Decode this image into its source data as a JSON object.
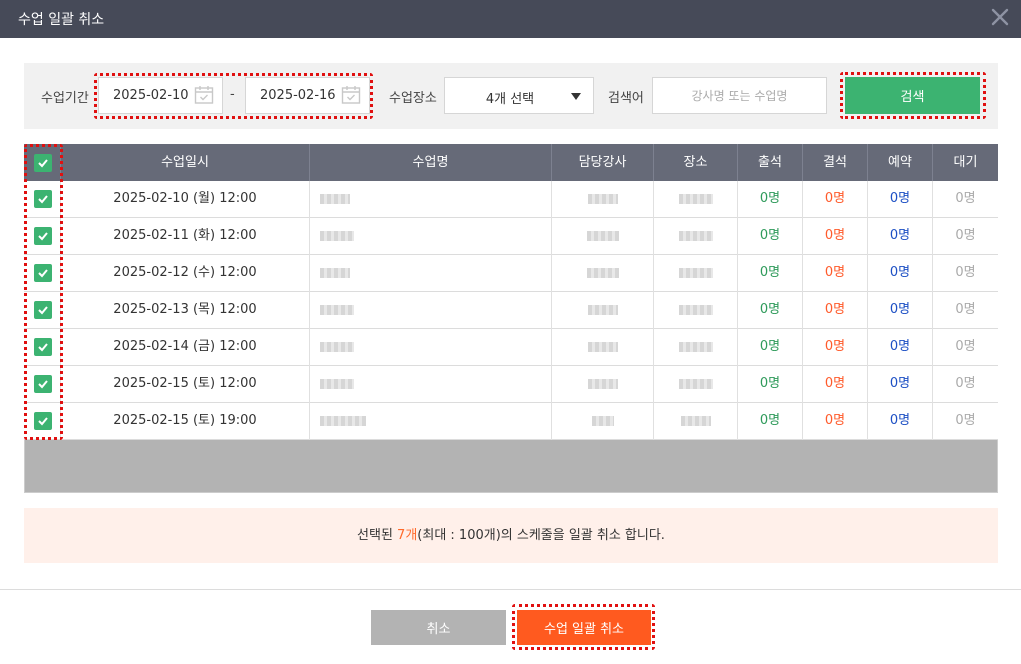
{
  "dialog": {
    "title": "수업 일괄 취소",
    "close_icon": "close-icon"
  },
  "filter": {
    "period_label": "수업기간",
    "start_date": "2025-02-10",
    "separator": "-",
    "end_date": "2025-02-16",
    "calendar_icon": "calendar-icon",
    "place_label": "수업장소",
    "place_selected": "4개 선택",
    "keyword_label": "검색어",
    "keyword_value": "",
    "keyword_placeholder": "강사명 또는 수업명",
    "search_button": "검색"
  },
  "table": {
    "headers": [
      "수업일시",
      "수업명",
      "담당강사",
      "장소",
      "출석",
      "결석",
      "예약",
      "대기"
    ],
    "header_checked": true,
    "rows": [
      {
        "datetime": "2025-02-10 (월) 12:00",
        "checked": true,
        "attend": "0명",
        "absent": "0명",
        "reserve": "0명",
        "wait": "0명"
      },
      {
        "datetime": "2025-02-11 (화) 12:00",
        "checked": true,
        "attend": "0명",
        "absent": "0명",
        "reserve": "0명",
        "wait": "0명"
      },
      {
        "datetime": "2025-02-12 (수) 12:00",
        "checked": true,
        "attend": "0명",
        "absent": "0명",
        "reserve": "0명",
        "wait": "0명"
      },
      {
        "datetime": "2025-02-13 (목) 12:00",
        "checked": true,
        "attend": "0명",
        "absent": "0명",
        "reserve": "0명",
        "wait": "0명"
      },
      {
        "datetime": "2025-02-14 (금) 12:00",
        "checked": true,
        "attend": "0명",
        "absent": "0명",
        "reserve": "0명",
        "wait": "0명"
      },
      {
        "datetime": "2025-02-15 (토) 12:00",
        "checked": true,
        "attend": "0명",
        "absent": "0명",
        "reserve": "0명",
        "wait": "0명"
      },
      {
        "datetime": "2025-02-15 (토) 19:00",
        "checked": true,
        "attend": "0명",
        "absent": "0명",
        "reserve": "0명",
        "wait": "0명"
      }
    ]
  },
  "notice": {
    "prefix": "선택된 ",
    "count": "7개",
    "suffix": "(최대 : 100개)의 스케줄을 일괄 취소 합니다."
  },
  "footer": {
    "cancel_button": "취소",
    "bulk_cancel_button": "수업 일괄 취소"
  },
  "colors": {
    "title_bar": "#464a58",
    "header": "#666a78",
    "green": "#3cb371",
    "orange": "#ff5a1f",
    "highlight": "#e01010"
  }
}
